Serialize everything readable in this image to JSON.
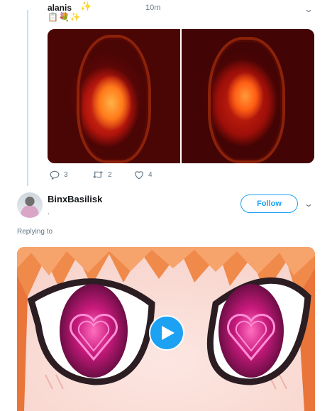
{
  "tweet1": {
    "user_name": "alanis",
    "name_emoji": "sparkles-icon",
    "time": "10m",
    "bio_emojis": [
      "notepad-icon",
      "bouquet-icon",
      "sparkles-icon"
    ],
    "images": [
      "red-mirror-photo-left",
      "red-mirror-photo-right"
    ],
    "replies": "3",
    "retweets": "2",
    "likes": "4"
  },
  "tweet2": {
    "user_name": "BinxBasilisk",
    "handle": ",",
    "follow_label": "Follow",
    "replying_label": "Replying to",
    "media": "anime-heart-eyes-video",
    "play_icon": "play-icon"
  },
  "colors": {
    "accent": "#1da1f2",
    "thread_line": "#c4e3f7",
    "muted_text": "#657786"
  }
}
